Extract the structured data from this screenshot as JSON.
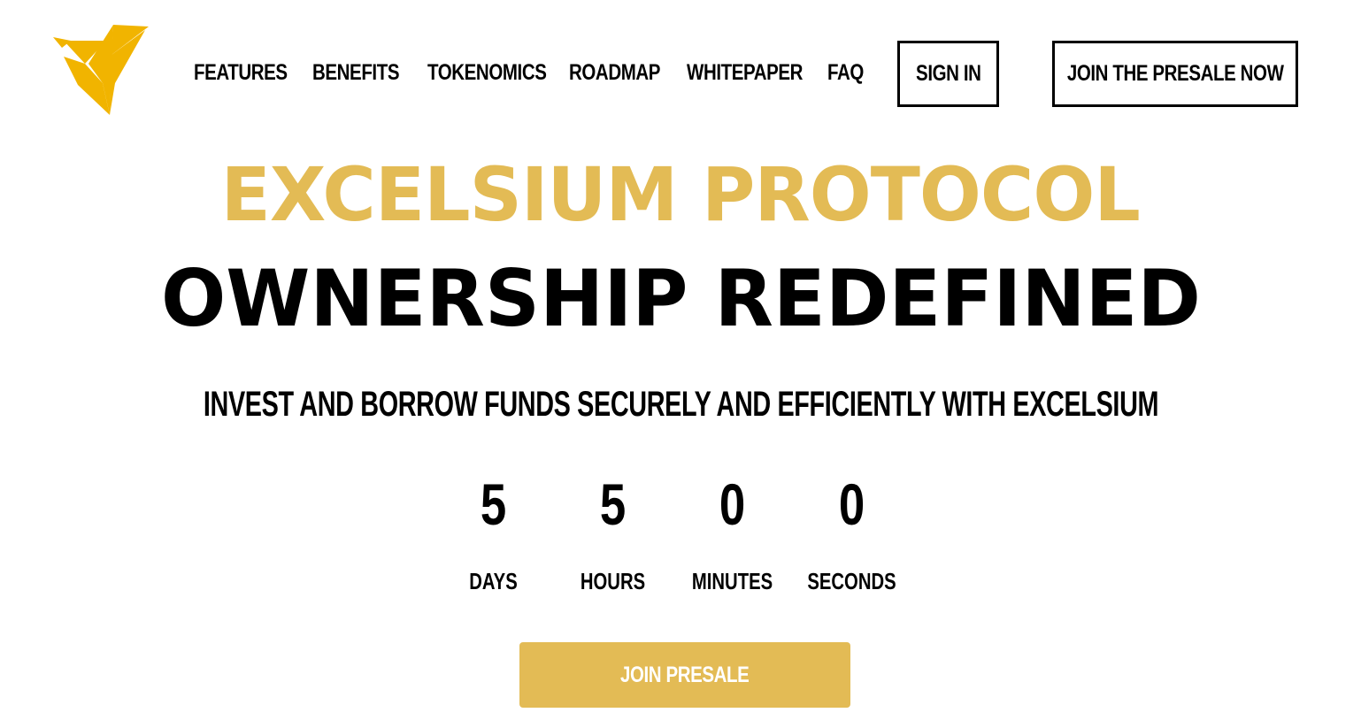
{
  "brand": {
    "logo_icon": "origami-bird-logo-icon",
    "accent_color": "#e3bb55",
    "logo_color": "#f1b400"
  },
  "nav": {
    "links": [
      "FEATURES",
      "BENEFITS",
      "TOKENOMICS",
      "ROADMAP",
      "WHITEPAPER",
      "FAQ"
    ],
    "sign_in": "SIGN IN",
    "join_presale_now": "JOIN THE PRESALE NOW"
  },
  "hero": {
    "title": "EXCELSIUM PROTOCOL",
    "subtitle": "OWNERSHIP REDEFINED",
    "tagline": "INVEST AND BORROW FUNDS SECURELY AND EFFICIENTLY WITH EXCELSIUM"
  },
  "countdown": [
    {
      "value": "5",
      "label": "DAYS"
    },
    {
      "value": "5",
      "label": "HOURS"
    },
    {
      "value": "0",
      "label": "MINUTES"
    },
    {
      "value": "0",
      "label": "SECONDS"
    }
  ],
  "cta": {
    "join_presale": "JOIN PRESALE"
  }
}
